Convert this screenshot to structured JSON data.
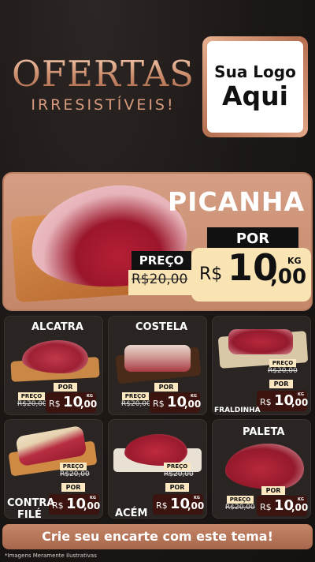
{
  "header": {
    "title": "OFERTAS",
    "subtitle": "IRRESISTÍVEIS!",
    "logo_line1": "Sua Logo",
    "logo_line2": "Aqui"
  },
  "hero": {
    "name": "PICANHA",
    "preco_label": "PREÇO",
    "old_price": "R$20,00",
    "por_label": "POR",
    "currency": "R$",
    "price_int": "10",
    "price_dec": ",00",
    "unit": "KG"
  },
  "products": [
    {
      "name": "ALCATRA",
      "preco_label": "PREÇO",
      "old_price": "R$20,00",
      "por_label": "POR",
      "currency": "R$",
      "price_int": "10",
      "price_dec": ",00",
      "unit": "KG"
    },
    {
      "name": "COSTELA",
      "preco_label": "PREÇO",
      "old_price": "R$20,00",
      "por_label": "POR",
      "currency": "R$",
      "price_int": "10",
      "price_dec": ",00",
      "unit": "KG"
    },
    {
      "name": "FRALDINHA",
      "preco_label": "PREÇO",
      "old_price": "R$20,00",
      "por_label": "POR",
      "currency": "R$",
      "price_int": "10",
      "price_dec": ",00",
      "unit": "KG"
    },
    {
      "name": "CONTRA FILÉ",
      "name_line1": "CONTRA",
      "name_line2": "FILÉ",
      "preco_label": "PREÇO",
      "old_price": "R$20,00",
      "por_label": "POR",
      "currency": "R$",
      "price_int": "10",
      "price_dec": ",00",
      "unit": "KG"
    },
    {
      "name": "ACÉM",
      "preco_label": "PREÇO",
      "old_price": "R$20,00",
      "por_label": "POR",
      "currency": "R$",
      "price_int": "10",
      "price_dec": ",00",
      "unit": "KG"
    },
    {
      "name": "PALETA",
      "preco_label": "PREÇO",
      "old_price": "R$20,00",
      "por_label": "POR",
      "currency": "R$",
      "price_int": "10",
      "price_dec": ",00",
      "unit": "KG"
    }
  ],
  "cta": {
    "label": "Crie seu encarte com este tema!"
  },
  "disclaimer": "*Imagens Meramente Ilustrativas",
  "colors": {
    "background": "#1b1715",
    "accent_copper": "#c48769",
    "price_cream": "#fbe4b4",
    "price_dark_red": "#3b140f"
  }
}
